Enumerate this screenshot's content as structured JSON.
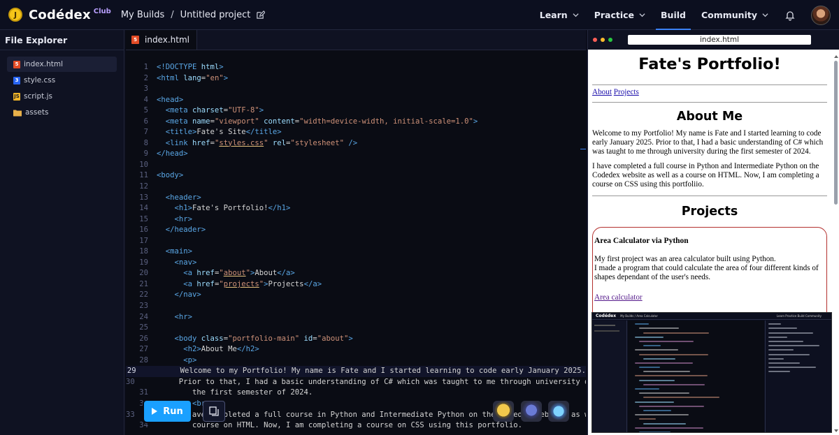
{
  "topbar": {
    "logo_text": "Codédex",
    "logo_badge": "Club",
    "crumb_builds": "My Builds",
    "crumb_sep": "/",
    "crumb_project": "Untitled project",
    "nav": [
      {
        "label": "Learn"
      },
      {
        "label": "Practice"
      },
      {
        "label": "Build"
      },
      {
        "label": "Community"
      }
    ]
  },
  "sidebar": {
    "title": "File Explorer",
    "files": [
      {
        "name": "index.html",
        "kind": "html",
        "active": true
      },
      {
        "name": "style.css",
        "kind": "css",
        "active": false
      },
      {
        "name": "script.js",
        "kind": "js",
        "active": false
      },
      {
        "name": "assets",
        "kind": "folder",
        "active": false
      }
    ]
  },
  "editor": {
    "tab_label": "index.html",
    "current_line": 29,
    "run_label": "Run",
    "lines": [
      {
        "n": "1",
        "segs": [
          {
            "c": "t-doc",
            "t": "<!DOCTYPE "
          },
          {
            "c": "t-attr",
            "t": "html"
          },
          {
            "c": "t-doc",
            "t": ">"
          }
        ]
      },
      {
        "n": "2",
        "segs": [
          {
            "c": "t-tag",
            "t": "<html "
          },
          {
            "c": "t-attr",
            "t": "lang"
          },
          {
            "c": "",
            "t": "="
          },
          {
            "c": "t-str",
            "t": "\"en\""
          },
          {
            "c": "t-tag",
            "t": ">"
          }
        ]
      },
      {
        "n": "3",
        "segs": []
      },
      {
        "n": "4",
        "segs": [
          {
            "c": "t-tag",
            "t": "<head>"
          }
        ]
      },
      {
        "n": "5",
        "segs": [
          {
            "c": "",
            "t": "  "
          },
          {
            "c": "t-tag",
            "t": "<meta "
          },
          {
            "c": "t-attr",
            "t": "charset"
          },
          {
            "c": "",
            "t": "="
          },
          {
            "c": "t-str",
            "t": "\"UTF-8\""
          },
          {
            "c": "t-tag",
            "t": ">"
          }
        ]
      },
      {
        "n": "6",
        "segs": [
          {
            "c": "",
            "t": "  "
          },
          {
            "c": "t-tag",
            "t": "<meta "
          },
          {
            "c": "t-attr",
            "t": "name"
          },
          {
            "c": "",
            "t": "="
          },
          {
            "c": "t-str",
            "t": "\"viewport\""
          },
          {
            "c": "",
            "t": " "
          },
          {
            "c": "t-attr",
            "t": "content"
          },
          {
            "c": "",
            "t": "="
          },
          {
            "c": "t-str",
            "t": "\"width=device-width, initial-scale=1.0\""
          },
          {
            "c": "t-tag",
            "t": ">"
          }
        ]
      },
      {
        "n": "7",
        "segs": [
          {
            "c": "",
            "t": "  "
          },
          {
            "c": "t-tag",
            "t": "<title>"
          },
          {
            "c": "",
            "t": "Fate's Site"
          },
          {
            "c": "t-tag",
            "t": "</title>"
          }
        ]
      },
      {
        "n": "8",
        "segs": [
          {
            "c": "",
            "t": "  "
          },
          {
            "c": "t-tag",
            "t": "<link "
          },
          {
            "c": "t-attr",
            "t": "href"
          },
          {
            "c": "",
            "t": "="
          },
          {
            "c": "t-str",
            "t": "\""
          },
          {
            "c": "t-link",
            "t": "styles.css"
          },
          {
            "c": "t-str",
            "t": "\""
          },
          {
            "c": "",
            "t": " "
          },
          {
            "c": "t-attr",
            "t": "rel"
          },
          {
            "c": "",
            "t": "="
          },
          {
            "c": "t-str",
            "t": "\"stylesheet\""
          },
          {
            "c": "t-tag",
            "t": " />"
          }
        ]
      },
      {
        "n": "9",
        "segs": [
          {
            "c": "t-tag",
            "t": "</head>"
          }
        ]
      },
      {
        "n": "10",
        "segs": []
      },
      {
        "n": "11",
        "segs": [
          {
            "c": "t-tag",
            "t": "<body>"
          }
        ]
      },
      {
        "n": "12",
        "segs": []
      },
      {
        "n": "13",
        "segs": [
          {
            "c": "",
            "t": "  "
          },
          {
            "c": "t-tag",
            "t": "<header>"
          }
        ]
      },
      {
        "n": "14",
        "segs": [
          {
            "c": "",
            "t": "    "
          },
          {
            "c": "t-tag",
            "t": "<h1>"
          },
          {
            "c": "",
            "t": "Fate's Portfolio!"
          },
          {
            "c": "t-tag",
            "t": "</h1>"
          }
        ]
      },
      {
        "n": "15",
        "segs": [
          {
            "c": "",
            "t": "    "
          },
          {
            "c": "t-tag",
            "t": "<hr>"
          }
        ]
      },
      {
        "n": "16",
        "segs": [
          {
            "c": "",
            "t": "  "
          },
          {
            "c": "t-tag",
            "t": "</header>"
          }
        ]
      },
      {
        "n": "17",
        "segs": []
      },
      {
        "n": "18",
        "segs": [
          {
            "c": "",
            "t": "  "
          },
          {
            "c": "t-tag",
            "t": "<main>"
          }
        ]
      },
      {
        "n": "19",
        "segs": [
          {
            "c": "",
            "t": "    "
          },
          {
            "c": "t-tag",
            "t": "<nav>"
          }
        ]
      },
      {
        "n": "20",
        "segs": [
          {
            "c": "",
            "t": "      "
          },
          {
            "c": "t-tag",
            "t": "<a "
          },
          {
            "c": "t-attr",
            "t": "href"
          },
          {
            "c": "",
            "t": "="
          },
          {
            "c": "t-str",
            "t": "\""
          },
          {
            "c": "t-link",
            "t": "about"
          },
          {
            "c": "t-str",
            "t": "\""
          },
          {
            "c": "t-tag",
            "t": ">"
          },
          {
            "c": "",
            "t": "About"
          },
          {
            "c": "t-tag",
            "t": "</a>"
          }
        ]
      },
      {
        "n": "21",
        "segs": [
          {
            "c": "",
            "t": "      "
          },
          {
            "c": "t-tag",
            "t": "<a "
          },
          {
            "c": "t-attr",
            "t": "href"
          },
          {
            "c": "",
            "t": "="
          },
          {
            "c": "t-str",
            "t": "\""
          },
          {
            "c": "t-link",
            "t": "projects"
          },
          {
            "c": "t-str",
            "t": "\""
          },
          {
            "c": "t-tag",
            "t": ">"
          },
          {
            "c": "",
            "t": "Projects"
          },
          {
            "c": "t-tag",
            "t": "</a>"
          }
        ]
      },
      {
        "n": "22",
        "segs": [
          {
            "c": "",
            "t": "    "
          },
          {
            "c": "t-tag",
            "t": "</nav>"
          }
        ]
      },
      {
        "n": "23",
        "segs": []
      },
      {
        "n": "24",
        "segs": [
          {
            "c": "",
            "t": "    "
          },
          {
            "c": "t-tag",
            "t": "<hr>"
          }
        ]
      },
      {
        "n": "25",
        "segs": []
      },
      {
        "n": "26",
        "segs": [
          {
            "c": "",
            "t": "    "
          },
          {
            "c": "t-tag",
            "t": "<body "
          },
          {
            "c": "t-attr",
            "t": "class"
          },
          {
            "c": "",
            "t": "="
          },
          {
            "c": "t-str",
            "t": "\"portfolio-main\""
          },
          {
            "c": "",
            "t": " "
          },
          {
            "c": "t-attr",
            "t": "id"
          },
          {
            "c": "",
            "t": "="
          },
          {
            "c": "t-str",
            "t": "\"about\""
          },
          {
            "c": "t-tag",
            "t": ">"
          }
        ]
      },
      {
        "n": "27",
        "segs": [
          {
            "c": "",
            "t": "      "
          },
          {
            "c": "t-tag",
            "t": "<h2>"
          },
          {
            "c": "",
            "t": "About Me"
          },
          {
            "c": "t-tag",
            "t": "</h2>"
          }
        ]
      },
      {
        "n": "28",
        "segs": [
          {
            "c": "",
            "t": "      "
          },
          {
            "c": "t-tag",
            "t": "<p>"
          }
        ]
      },
      {
        "n": "29",
        "segs": [
          {
            "c": "",
            "t": "        Welcome to my Portfolio! My name is Fate and I started learning to code early January 2025."
          }
        ]
      },
      {
        "n": "30",
        "segs": [
          {
            "c": "",
            "t": "        Prior to that, I had a basic understanding of C# which was taught to me through university during"
          }
        ]
      },
      {
        "n": "31",
        "segs": [
          {
            "c": "",
            "t": "        the first semester of 2024."
          }
        ]
      },
      {
        "n": "32",
        "segs": [
          {
            "c": "",
            "t": "        "
          },
          {
            "c": "t-tag",
            "t": "<br>"
          }
        ]
      },
      {
        "n": "33",
        "segs": [
          {
            "c": "",
            "t": "        I have completed a full course in Python and Intermediate Python on the Codedex website as well as a"
          }
        ]
      },
      {
        "n": "34",
        "segs": [
          {
            "c": "",
            "t": "        course on HTML. Now, I am completing a course on CSS using this portfolio."
          }
        ]
      }
    ]
  },
  "preview": {
    "url": "index.html",
    "h1": "Fate's Portfolio!",
    "nav_about": "About",
    "nav_projects": "Projects",
    "about_heading": "About Me",
    "about_p1": "Welcome to my Portfolio! My name is Fate and I started learning to code early January 2025. Prior to that, I had a basic understanding of C# which was taught to me through university during the first semester of 2024.",
    "about_p2": "I have completed a full course in Python and Intermediate Python on the Codedex website as well as a course on HTML. Now, I am completing a course on CSS using this portfoliio.",
    "projects_heading": "Projects",
    "card_title": "Area Calculator via Python",
    "card_p1": "My first project was an area calculator built using Python.",
    "card_p2": "I made a program that could calculate the area of four different kinds of shapes dependant of the user's needs.",
    "card_link": "Area calculator",
    "thumb": {
      "logo": "Codédex",
      "crumb": "My Builds / Area Calculator",
      "nav": "Learn  Practice  Build  Community"
    }
  }
}
